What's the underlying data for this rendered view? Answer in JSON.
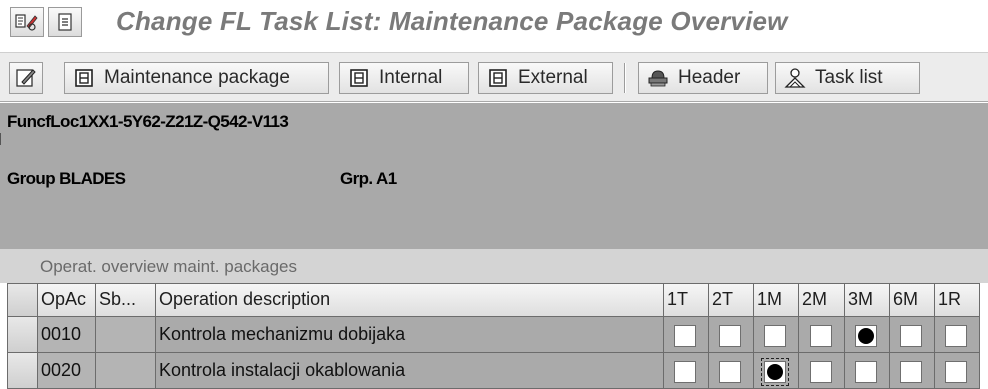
{
  "title": {
    "text": "Change FL Task List: Maintenance Package Overview",
    "icons": [
      "display-change-icon",
      "notes-icon"
    ]
  },
  "toolbar": {
    "buttons": [
      {
        "label": "",
        "icon": "edit-icon"
      },
      {
        "label": "Maintenance package",
        "icon": "package-icon"
      },
      {
        "label": "Internal",
        "icon": "package-icon"
      },
      {
        "label": "External",
        "icon": "package-icon"
      },
      {
        "label": "Header",
        "icon": "header-icon"
      },
      {
        "label": "Task list",
        "icon": "task-list-icon"
      }
    ]
  },
  "header": {
    "func_loc": "FuncfLoc1XX1-5Y62-Z21Z-Q542-V113",
    "group": "Group BLADES",
    "grp": "Grp. A1"
  },
  "section": {
    "label": "Operat. overview maint. packages"
  },
  "table": {
    "columns": [
      "OpAc",
      "Sb...",
      "Operation description",
      "1T",
      "2T",
      "1M",
      "2M",
      "3M",
      "6M",
      "1R"
    ],
    "rows": [
      {
        "opac": "0010",
        "sb": "",
        "description": "Kontrola mechanizmu dobijaka",
        "packages": [
          false,
          false,
          false,
          false,
          true,
          false,
          false
        ]
      },
      {
        "opac": "0020",
        "sb": "",
        "description": "Kontrola instalacji okablowania",
        "packages": [
          false,
          false,
          true,
          false,
          false,
          false,
          false
        ]
      }
    ]
  },
  "colors": {
    "title_text": "#7a7a7a",
    "header_bg": "#a9a9a9",
    "toolbar_bg": "#ececec"
  }
}
